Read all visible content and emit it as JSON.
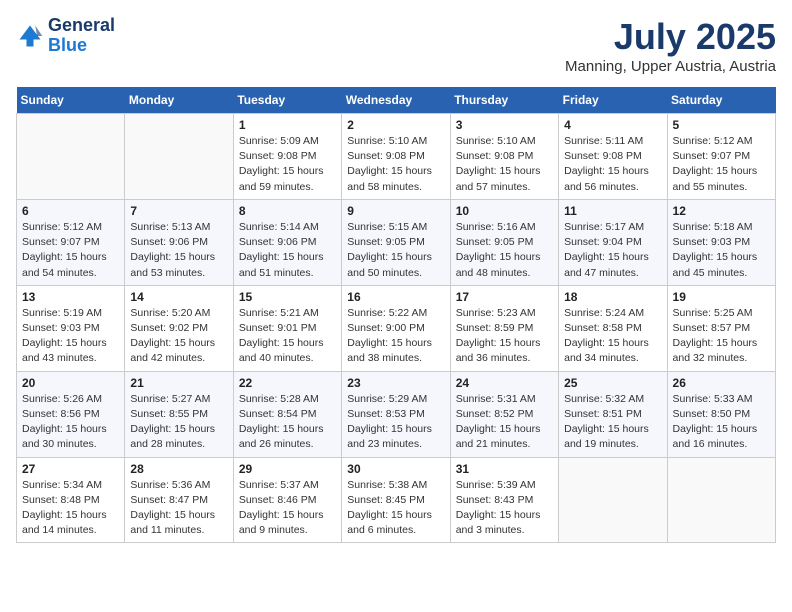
{
  "header": {
    "logo_line1": "General",
    "logo_line2": "Blue",
    "month_year": "July 2025",
    "location": "Manning, Upper Austria, Austria"
  },
  "weekdays": [
    "Sunday",
    "Monday",
    "Tuesday",
    "Wednesday",
    "Thursday",
    "Friday",
    "Saturday"
  ],
  "weeks": [
    [
      {
        "day": "",
        "info": ""
      },
      {
        "day": "",
        "info": ""
      },
      {
        "day": "1",
        "info": "Sunrise: 5:09 AM\nSunset: 9:08 PM\nDaylight: 15 hours\nand 59 minutes."
      },
      {
        "day": "2",
        "info": "Sunrise: 5:10 AM\nSunset: 9:08 PM\nDaylight: 15 hours\nand 58 minutes."
      },
      {
        "day": "3",
        "info": "Sunrise: 5:10 AM\nSunset: 9:08 PM\nDaylight: 15 hours\nand 57 minutes."
      },
      {
        "day": "4",
        "info": "Sunrise: 5:11 AM\nSunset: 9:08 PM\nDaylight: 15 hours\nand 56 minutes."
      },
      {
        "day": "5",
        "info": "Sunrise: 5:12 AM\nSunset: 9:07 PM\nDaylight: 15 hours\nand 55 minutes."
      }
    ],
    [
      {
        "day": "6",
        "info": "Sunrise: 5:12 AM\nSunset: 9:07 PM\nDaylight: 15 hours\nand 54 minutes."
      },
      {
        "day": "7",
        "info": "Sunrise: 5:13 AM\nSunset: 9:06 PM\nDaylight: 15 hours\nand 53 minutes."
      },
      {
        "day": "8",
        "info": "Sunrise: 5:14 AM\nSunset: 9:06 PM\nDaylight: 15 hours\nand 51 minutes."
      },
      {
        "day": "9",
        "info": "Sunrise: 5:15 AM\nSunset: 9:05 PM\nDaylight: 15 hours\nand 50 minutes."
      },
      {
        "day": "10",
        "info": "Sunrise: 5:16 AM\nSunset: 9:05 PM\nDaylight: 15 hours\nand 48 minutes."
      },
      {
        "day": "11",
        "info": "Sunrise: 5:17 AM\nSunset: 9:04 PM\nDaylight: 15 hours\nand 47 minutes."
      },
      {
        "day": "12",
        "info": "Sunrise: 5:18 AM\nSunset: 9:03 PM\nDaylight: 15 hours\nand 45 minutes."
      }
    ],
    [
      {
        "day": "13",
        "info": "Sunrise: 5:19 AM\nSunset: 9:03 PM\nDaylight: 15 hours\nand 43 minutes."
      },
      {
        "day": "14",
        "info": "Sunrise: 5:20 AM\nSunset: 9:02 PM\nDaylight: 15 hours\nand 42 minutes."
      },
      {
        "day": "15",
        "info": "Sunrise: 5:21 AM\nSunset: 9:01 PM\nDaylight: 15 hours\nand 40 minutes."
      },
      {
        "day": "16",
        "info": "Sunrise: 5:22 AM\nSunset: 9:00 PM\nDaylight: 15 hours\nand 38 minutes."
      },
      {
        "day": "17",
        "info": "Sunrise: 5:23 AM\nSunset: 8:59 PM\nDaylight: 15 hours\nand 36 minutes."
      },
      {
        "day": "18",
        "info": "Sunrise: 5:24 AM\nSunset: 8:58 PM\nDaylight: 15 hours\nand 34 minutes."
      },
      {
        "day": "19",
        "info": "Sunrise: 5:25 AM\nSunset: 8:57 PM\nDaylight: 15 hours\nand 32 minutes."
      }
    ],
    [
      {
        "day": "20",
        "info": "Sunrise: 5:26 AM\nSunset: 8:56 PM\nDaylight: 15 hours\nand 30 minutes."
      },
      {
        "day": "21",
        "info": "Sunrise: 5:27 AM\nSunset: 8:55 PM\nDaylight: 15 hours\nand 28 minutes."
      },
      {
        "day": "22",
        "info": "Sunrise: 5:28 AM\nSunset: 8:54 PM\nDaylight: 15 hours\nand 26 minutes."
      },
      {
        "day": "23",
        "info": "Sunrise: 5:29 AM\nSunset: 8:53 PM\nDaylight: 15 hours\nand 23 minutes."
      },
      {
        "day": "24",
        "info": "Sunrise: 5:31 AM\nSunset: 8:52 PM\nDaylight: 15 hours\nand 21 minutes."
      },
      {
        "day": "25",
        "info": "Sunrise: 5:32 AM\nSunset: 8:51 PM\nDaylight: 15 hours\nand 19 minutes."
      },
      {
        "day": "26",
        "info": "Sunrise: 5:33 AM\nSunset: 8:50 PM\nDaylight: 15 hours\nand 16 minutes."
      }
    ],
    [
      {
        "day": "27",
        "info": "Sunrise: 5:34 AM\nSunset: 8:48 PM\nDaylight: 15 hours\nand 14 minutes."
      },
      {
        "day": "28",
        "info": "Sunrise: 5:36 AM\nSunset: 8:47 PM\nDaylight: 15 hours\nand 11 minutes."
      },
      {
        "day": "29",
        "info": "Sunrise: 5:37 AM\nSunset: 8:46 PM\nDaylight: 15 hours\nand 9 minutes."
      },
      {
        "day": "30",
        "info": "Sunrise: 5:38 AM\nSunset: 8:45 PM\nDaylight: 15 hours\nand 6 minutes."
      },
      {
        "day": "31",
        "info": "Sunrise: 5:39 AM\nSunset: 8:43 PM\nDaylight: 15 hours\nand 3 minutes."
      },
      {
        "day": "",
        "info": ""
      },
      {
        "day": "",
        "info": ""
      }
    ]
  ]
}
